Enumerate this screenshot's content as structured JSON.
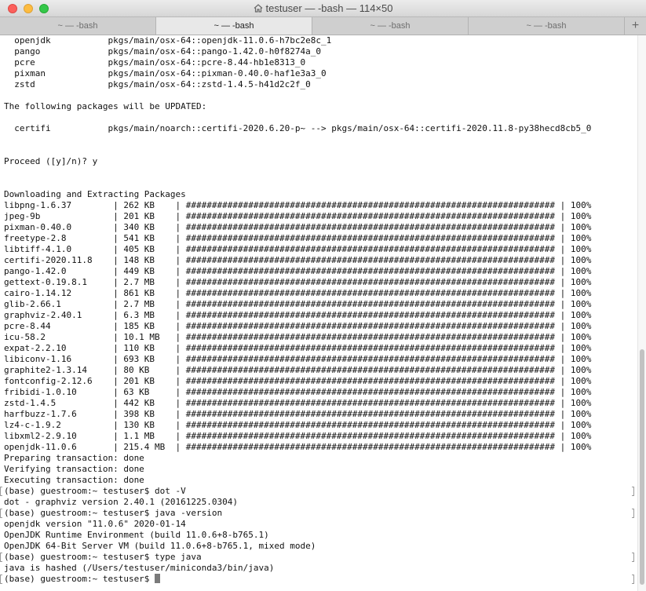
{
  "window": {
    "title": "testuser — -bash — 114×50"
  },
  "tabs": [
    {
      "label": "~ — -bash",
      "active": false
    },
    {
      "label": "~ — -bash",
      "active": true
    },
    {
      "label": "~ — -bash",
      "active": false
    },
    {
      "label": "~ — -bash",
      "active": false
    }
  ],
  "tab_add_label": "+",
  "colors": {
    "close": "#fc605c",
    "minimize": "#fdbc40",
    "maximize": "#34c749"
  },
  "terminal_lines": [
    {
      "text": "  openjdk           pkgs/main/osx-64::openjdk-11.0.6-h7bc2e8c_1"
    },
    {
      "text": "  pango             pkgs/main/osx-64::pango-1.42.0-h0f8274a_0"
    },
    {
      "text": "  pcre              pkgs/main/osx-64::pcre-8.44-hb1e8313_0"
    },
    {
      "text": "  pixman            pkgs/main/osx-64::pixman-0.40.0-haf1e3a3_0"
    },
    {
      "text": "  zstd              pkgs/main/osx-64::zstd-1.4.5-h41d2c2f_0"
    },
    {
      "text": ""
    },
    {
      "text": "The following packages will be UPDATED:"
    },
    {
      "text": ""
    },
    {
      "text": "  certifi           pkgs/main/noarch::certifi-2020.6.20-p~ --> pkgs/main/osx-64::certifi-2020.11.8-py38hecd8cb5_0"
    },
    {
      "text": ""
    },
    {
      "text": ""
    },
    {
      "text": "Proceed ([y]/n)? y"
    },
    {
      "text": ""
    },
    {
      "text": ""
    },
    {
      "text": "Downloading and Extracting Packages"
    },
    {
      "text": "libpng-1.6.37        | 262 KB    | ####################################################################### | 100%"
    },
    {
      "text": "jpeg-9b              | 201 KB    | ####################################################################### | 100%"
    },
    {
      "text": "pixman-0.40.0        | 340 KB    | ####################################################################### | 100%"
    },
    {
      "text": "freetype-2.8         | 541 KB    | ####################################################################### | 100%"
    },
    {
      "text": "libtiff-4.1.0        | 405 KB    | ####################################################################### | 100%"
    },
    {
      "text": "certifi-2020.11.8    | 148 KB    | ####################################################################### | 100%"
    },
    {
      "text": "pango-1.42.0         | 449 KB    | ####################################################################### | 100%"
    },
    {
      "text": "gettext-0.19.8.1     | 2.7 MB    | ####################################################################### | 100%"
    },
    {
      "text": "cairo-1.14.12        | 861 KB    | ####################################################################### | 100%"
    },
    {
      "text": "glib-2.66.1          | 2.7 MB    | ####################################################################### | 100%"
    },
    {
      "text": "graphviz-2.40.1      | 6.3 MB    | ####################################################################### | 100%"
    },
    {
      "text": "pcre-8.44            | 185 KB    | ####################################################################### | 100%"
    },
    {
      "text": "icu-58.2             | 10.1 MB   | ####################################################################### | 100%"
    },
    {
      "text": "expat-2.2.10         | 110 KB    | ####################################################################### | 100%"
    },
    {
      "text": "libiconv-1.16        | 693 KB    | ####################################################################### | 100%"
    },
    {
      "text": "graphite2-1.3.14     | 80 KB     | ####################################################################### | 100%"
    },
    {
      "text": "fontconfig-2.12.6    | 201 KB    | ####################################################################### | 100%"
    },
    {
      "text": "fribidi-1.0.10       | 63 KB     | ####################################################################### | 100%"
    },
    {
      "text": "zstd-1.4.5           | 442 KB    | ####################################################################### | 100%"
    },
    {
      "text": "harfbuzz-1.7.6       | 398 KB    | ####################################################################### | 100%"
    },
    {
      "text": "lz4-c-1.9.2          | 130 KB    | ####################################################################### | 100%"
    },
    {
      "text": "libxml2-2.9.10       | 1.1 MB    | ####################################################################### | 100%"
    },
    {
      "text": "openjdk-11.0.6       | 215.4 MB  | ####################################################################### | 100%"
    },
    {
      "text": "Preparing transaction: done"
    },
    {
      "text": "Verifying transaction: done"
    },
    {
      "text": "Executing transaction: done"
    },
    {
      "text": "(base) guestroom:~ testuser$ dot -V",
      "mark": true
    },
    {
      "text": "dot - graphviz version 2.40.1 (20161225.0304)"
    },
    {
      "text": "(base) guestroom:~ testuser$ java -version",
      "mark": true
    },
    {
      "text": "openjdk version \"11.0.6\" 2020-01-14"
    },
    {
      "text": "OpenJDK Runtime Environment (build 11.0.6+8-b765.1)"
    },
    {
      "text": "OpenJDK 64-Bit Server VM (build 11.0.6+8-b765.1, mixed mode)"
    },
    {
      "text": "(base) guestroom:~ testuser$ type java",
      "mark": true
    },
    {
      "text": "java is hashed (/Users/testuser/miniconda3/bin/java)"
    },
    {
      "text": "(base) guestroom:~ testuser$ ",
      "mark": true,
      "cursor": true
    }
  ]
}
